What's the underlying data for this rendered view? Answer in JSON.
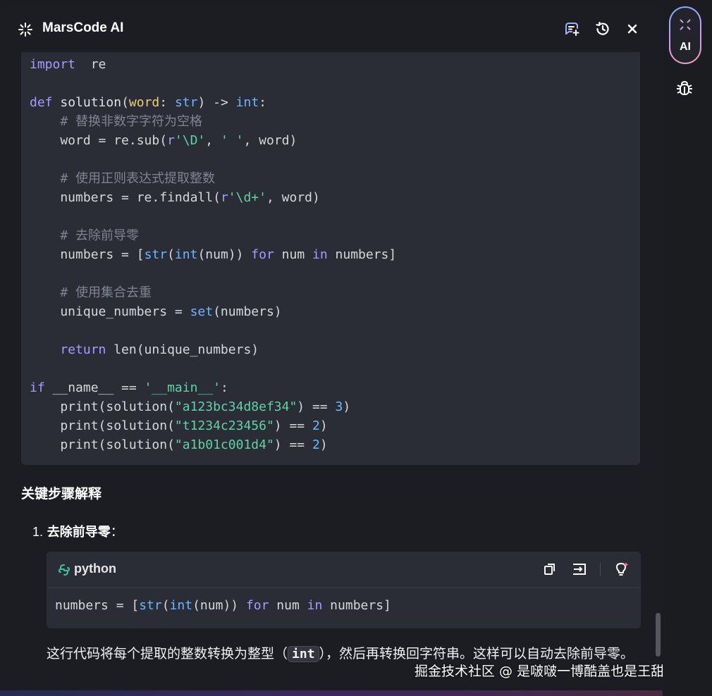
{
  "header": {
    "title": "MarsCode AI",
    "icons": [
      "sparkle-icon",
      "new-chat-icon",
      "history-icon",
      "close-icon"
    ]
  },
  "code": {
    "lines": [
      [
        [
          "kw",
          "import"
        ],
        [
          "",
          "  re"
        ]
      ],
      [],
      [
        [
          "kw",
          "def"
        ],
        [
          "fn",
          " solution"
        ],
        [
          "",
          "("
        ],
        [
          "param",
          "word"
        ],
        [
          "",
          ": "
        ],
        [
          "ty",
          "str"
        ],
        [
          "",
          ") -> "
        ],
        [
          "ty",
          "int"
        ],
        [
          "",
          ":"
        ]
      ],
      [
        [
          "cm",
          "    # 替换非数字字符为空格"
        ]
      ],
      [
        [
          "",
          "    word = re.sub("
        ],
        [
          "kw",
          "r"
        ],
        [
          "str",
          "'\\D'"
        ],
        [
          "",
          ", "
        ],
        [
          "str",
          "' '"
        ],
        [
          "",
          ", word)"
        ]
      ],
      [],
      [
        [
          "cm",
          "    # 使用正则表达式提取整数"
        ]
      ],
      [
        [
          "",
          "    numbers = re.findall("
        ],
        [
          "kw",
          "r"
        ],
        [
          "str",
          "'\\d+'"
        ],
        [
          "",
          ", word)"
        ]
      ],
      [],
      [
        [
          "cm",
          "    # 去除前导零"
        ]
      ],
      [
        [
          "",
          "    numbers = ["
        ],
        [
          "ty",
          "str"
        ],
        [
          "",
          "("
        ],
        [
          "ty",
          "int"
        ],
        [
          "",
          "(num)) "
        ],
        [
          "kw",
          "for"
        ],
        [
          "",
          " num "
        ],
        [
          "kw",
          "in"
        ],
        [
          "",
          " numbers]"
        ]
      ],
      [],
      [
        [
          "cm",
          "    # 使用集合去重"
        ]
      ],
      [
        [
          "",
          "    unique_numbers = "
        ],
        [
          "ty",
          "set"
        ],
        [
          "",
          "(numbers)"
        ]
      ],
      [],
      [
        [
          "kw",
          "    return"
        ],
        [
          "",
          " len(unique_numbers)"
        ]
      ],
      [],
      [
        [
          "kw",
          "if"
        ],
        [
          "",
          " __name__ == "
        ],
        [
          "str",
          "'__main__'"
        ],
        [
          "",
          ":"
        ]
      ],
      [
        [
          "",
          "    print(solution("
        ],
        [
          "str",
          "\"a123bc34d8ef34\""
        ],
        [
          "",
          ") == "
        ],
        [
          "num",
          "3"
        ],
        [
          "",
          ")"
        ]
      ],
      [
        [
          "",
          "    print(solution("
        ],
        [
          "str",
          "\"t1234c23456\""
        ],
        [
          "",
          ") == "
        ],
        [
          "num",
          "2"
        ],
        [
          "",
          ")"
        ]
      ],
      [
        [
          "",
          "    print(solution("
        ],
        [
          "str",
          "\"a1b01c001d4\""
        ],
        [
          "",
          ") == "
        ],
        [
          "num",
          "2"
        ],
        [
          "",
          ")"
        ]
      ]
    ]
  },
  "explain": {
    "section_title": "关键步骤解释",
    "item1_number": "1.",
    "item1_title": "去除前导零",
    "item1_colon": "："
  },
  "snippet": {
    "language": "python",
    "code_parts": [
      [
        "",
        "numbers = ["
      ],
      [
        "ty",
        "str"
      ],
      [
        "",
        "("
      ],
      [
        "ty",
        "int"
      ],
      [
        "",
        "(num)) "
      ],
      [
        "kw",
        "for"
      ],
      [
        "",
        " num "
      ],
      [
        "kw",
        "in"
      ],
      [
        "",
        " numbers]"
      ]
    ]
  },
  "paragraph": {
    "before": "这行代码将每个提取的整数转换为整型（",
    "inline_code": "int",
    "after": "），然后再转换回字符串。这样可以自动去除前导零。"
  },
  "watermark": "掘金技术社区 @ 是啵啵一博酷盖也是王甜甜",
  "sidebar": {
    "ai_label": "AI"
  },
  "colors": {
    "background": "#1c1d22",
    "code_bg": "#2b2d36",
    "keyword": "#a59cff",
    "type": "#6fb4ff",
    "string": "#5fd3a5",
    "number": "#62c0ff",
    "comment": "#7f8493",
    "param": "#f3d06f"
  }
}
